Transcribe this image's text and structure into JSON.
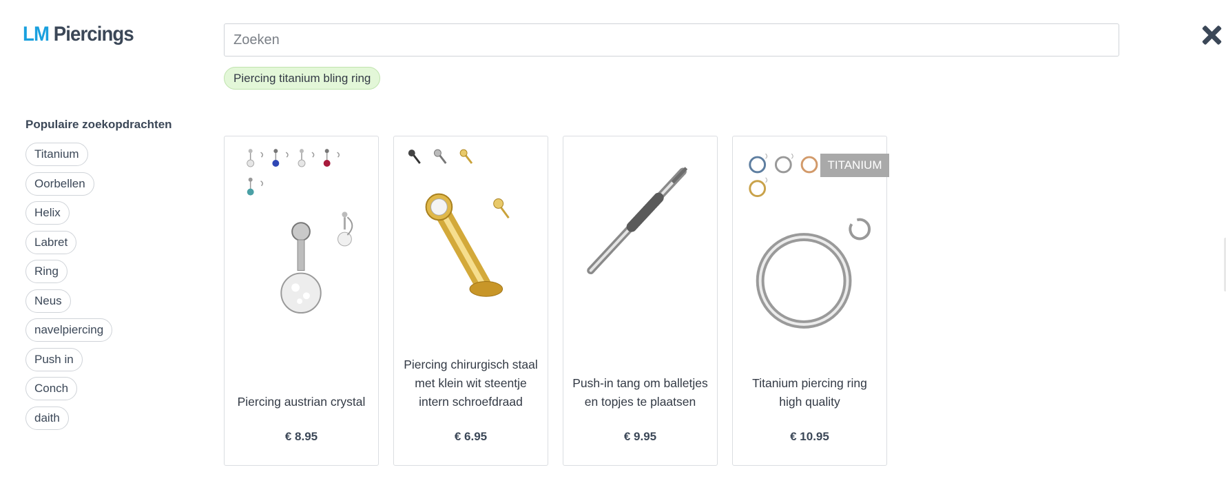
{
  "logo": {
    "part1": "LM",
    "part2": "Piercings"
  },
  "search": {
    "placeholder": "Zoeken",
    "value": ""
  },
  "suggestion": "Piercing titanium bling ring",
  "popular": {
    "title": "Populaire zoekopdrachten",
    "tags": [
      "Titanium",
      "Oorbellen",
      "Helix",
      "Labret",
      "Ring",
      "Neus",
      "navelpiercing",
      "Push in",
      "Conch",
      "daith"
    ]
  },
  "products": [
    {
      "name": "Piercing austrian crystal",
      "price": "€ 8.95",
      "image": "belly-ring-icon"
    },
    {
      "name": "Piercing chirurgisch staal met klein wit steentje intern schroefdraad",
      "price": "€ 6.95",
      "image": "labret-stud-icon"
    },
    {
      "name": "Push-in tang om balletjes en topjes te plaatsen",
      "price": "€ 9.95",
      "image": "tool-icon"
    },
    {
      "name": "Titanium piercing ring high quality",
      "price": "€ 10.95",
      "image": "hoop-ring-icon",
      "badge": "TITANIUM"
    }
  ],
  "colors": {
    "brand_blue": "#1aa0de",
    "brand_dark": "#3b4757",
    "suggestion_bg": "#e3f7d8",
    "badge_bg": "#a9a9a9"
  }
}
